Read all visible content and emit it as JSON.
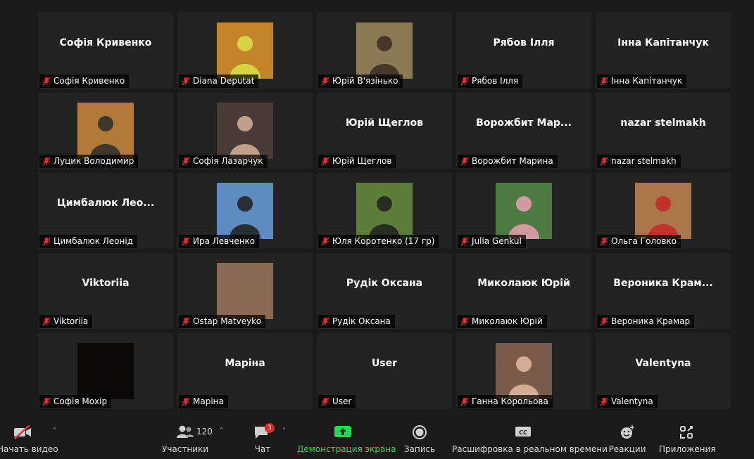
{
  "participants": [
    {
      "name": "Софія Кривенко",
      "label": "Софія Кривенко",
      "photo": false
    },
    {
      "name": "Diana Deputat",
      "label": "Diana Deputat",
      "photo": true,
      "bg": "#c4852a",
      "fg": "#d9e04a"
    },
    {
      "name": "Юрій В'язінько",
      "label": "Юрій В'язінько",
      "photo": true,
      "bg": "#8c7a55",
      "fg": "#3b2c22"
    },
    {
      "name": "Рябов  Ілля",
      "label": "Рябов  Ілля",
      "photo": false
    },
    {
      "name": "Інна Капітанчук",
      "label": "Інна Капітанчук",
      "photo": false
    },
    {
      "name": "Луцик Володимир",
      "label": "Луцик Володимир",
      "photo": true,
      "bg": "#b27a38",
      "fg": "#2a2a2a"
    },
    {
      "name": "Софія Лазарчук",
      "label": "Софія Лазарчук",
      "photo": true,
      "bg": "#4a3a38",
      "fg": "#d7b49a"
    },
    {
      "name": "Юрій Щеглов",
      "label": "Юрій Щеглов",
      "photo": false
    },
    {
      "name": "Ворожбит  Мар...",
      "label": "Ворожбит Марина",
      "photo": false
    },
    {
      "name": "nazar stelmakh",
      "label": "nazar stelmakh",
      "photo": false
    },
    {
      "name": "Цимбалюк  Лео...",
      "label": "Цимбалюк Леонід",
      "photo": false
    },
    {
      "name": "Ира Левченко",
      "label": "Ира Левченко",
      "photo": true,
      "bg": "#5f8cc0",
      "fg": "#1d1d1d"
    },
    {
      "name": "Юля Коротенко (17 гр)",
      "label": "Юля Коротенко (17 гр)",
      "photo": true,
      "bg": "#5f7d3a",
      "fg": "#1e1e1e"
    },
    {
      "name": "Julia Genkul",
      "label": "Julia Genkul",
      "photo": true,
      "bg": "#4c7a42",
      "fg": "#e8a0b0"
    },
    {
      "name": "Ольга Головко",
      "label": "Ольга Головко",
      "photo": true,
      "bg": "#a9774a",
      "fg": "#c8262a"
    },
    {
      "name": "Viktoriia",
      "label": "Viktoriia",
      "photo": false
    },
    {
      "name": "Ostap Matveyko",
      "label": "Ostap Matveyko",
      "photo": true,
      "bg": "#8a6a55",
      "fg": "#8a6a55"
    },
    {
      "name": "Рудік Оксана",
      "label": "Рудік Оксана",
      "photo": false
    },
    {
      "name": "Миколаюк Юрій",
      "label": "Миколаюк Юрій",
      "photo": false
    },
    {
      "name": "Вероника  Крам...",
      "label": "Вероника Крамар",
      "photo": false
    },
    {
      "name": "Софія Мохір",
      "label": "Софія Мохір",
      "photo": true,
      "bg": "#0b0808",
      "fg": "#0b0808"
    },
    {
      "name": "Маріна",
      "label": "Маріна",
      "photo": false
    },
    {
      "name": "User",
      "label": "User",
      "photo": false
    },
    {
      "name": "Ганна Корольова",
      "label": "Ганна Корольова",
      "photo": true,
      "bg": "#7a5a48",
      "fg": "#e2bba2"
    },
    {
      "name": "Valentyna",
      "label": "Valentyna",
      "photo": false
    }
  ],
  "toolbar": {
    "video_label": "Начать видео",
    "participants_label": "Участники",
    "participants_count": "120",
    "chat_label": "Чат",
    "chat_badge": "3",
    "share_label": "Демонстрация экрана",
    "record_label": "Запись",
    "transcript_label": "Расшифровка в реальном времени",
    "reactions_label": "Реакции",
    "apps_label": "Приложения",
    "share_color": "#23d959",
    "mute_color": "#e02e3a"
  }
}
